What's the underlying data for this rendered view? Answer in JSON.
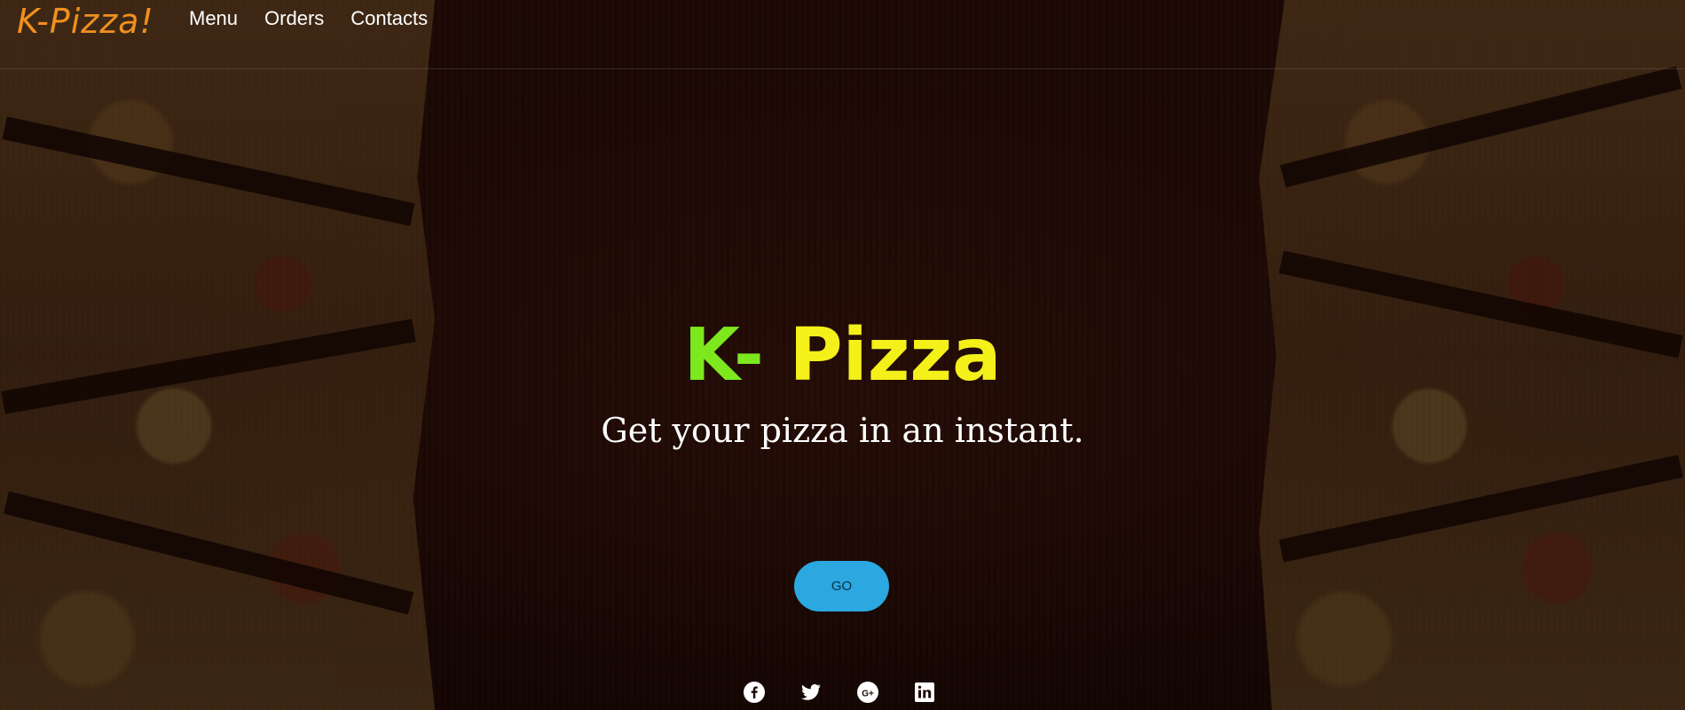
{
  "header": {
    "brand": "K-Pizza!",
    "nav": [
      {
        "label": "Menu"
      },
      {
        "label": "Orders"
      },
      {
        "label": "Contacts"
      }
    ]
  },
  "hero": {
    "title_prefix": "K-",
    "title_main": "Pizza",
    "subtitle": "Get your pizza in an instant.",
    "cta_label": "GO"
  },
  "socials": [
    {
      "icon": "facebook-icon"
    },
    {
      "icon": "twitter-icon"
    },
    {
      "icon": "google-plus-icon"
    },
    {
      "icon": "linkedin-icon"
    }
  ],
  "colors": {
    "brand": "#f0901e",
    "title_prefix": "#7ce81d",
    "title_main": "#f4f01a",
    "cta": "#2aa8df"
  }
}
